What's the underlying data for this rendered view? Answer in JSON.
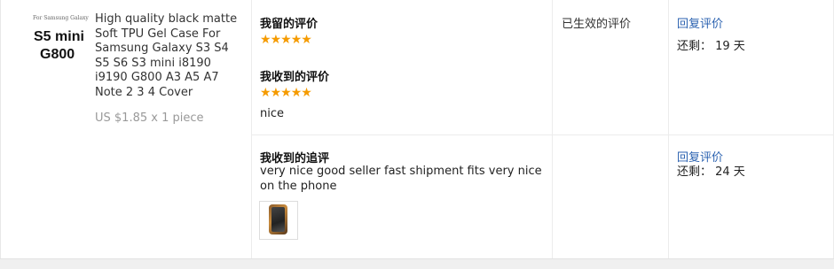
{
  "product": {
    "thumb_brand": "For Samsung Galaxy",
    "thumb_model_line1": "S5 mini",
    "thumb_model_line2": "G800",
    "title": "High quality black matte Soft TPU Gel Case For Samsung Galaxy S3 S4 S5 S6 S3 mini i8190 i9190 G800 A3 A5 A7 Note 2 3 4 Cover",
    "price": "US $1.85 x 1 piece"
  },
  "feedback": {
    "my_review_heading": "我留的评价",
    "my_review_stars": 5,
    "received_heading": "我收到的评价",
    "received_stars": 5,
    "received_text": "nice",
    "followup_heading": "我收到的追评",
    "followup_text": "very nice good seller fast shipment fits very nice on the phone"
  },
  "status": {
    "effective_label": "已生效的评价"
  },
  "actions": {
    "row1_reply": "回复评价",
    "row1_remaining": "还剩：  19 天",
    "row2_reply": "回复评价",
    "row2_remaining": "还剩：  24 天"
  },
  "icons": {
    "star": "star-icon",
    "photo": "phone-case-photo"
  },
  "colors": {
    "star": "#f59b00",
    "link": "#2b62b0",
    "price": "#999999"
  }
}
